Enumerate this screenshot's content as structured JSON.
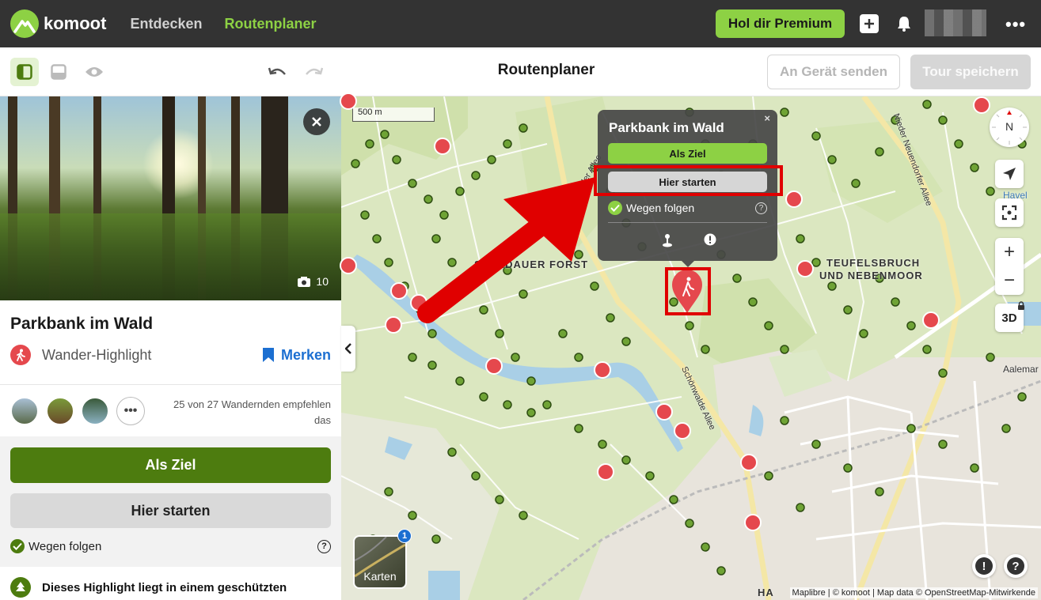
{
  "header": {
    "logo_text": "komoot",
    "nav": [
      {
        "label": "Entdecken",
        "active": false
      },
      {
        "label": "Routenplaner",
        "active": true
      }
    ],
    "premium_label": "Hol dir Premium",
    "more_label": "•••"
  },
  "toolbar": {
    "title": "Routenplaner",
    "send_label": "An Gerät senden",
    "save_label": "Tour speichern"
  },
  "sidebar": {
    "photo_count": "10",
    "highlight_title": "Parkbank im Wald",
    "highlight_type": "Wander-Highlight",
    "bookmark_label": "Merken",
    "recommend_text": "25 von 27 Wandernden empfehlen das",
    "more_avatars": "•••",
    "destination_label": "Als Ziel",
    "start_label": "Hier starten",
    "follow_paths_label": "Wegen folgen",
    "protected_text": "Dieses Highlight liegt in einem geschützten",
    "collapse_symbol": "‹"
  },
  "map": {
    "scale_label": "500 m",
    "labels": {
      "street_1": "Schönwalder Allee",
      "street_2": "Schönwalde Allee",
      "street_3": "Nieder Neuendorfer Allee",
      "area_1": "TEUFELSBRUCH",
      "area_2": "UND NEBENMOOR",
      "area_3": "SPANDAUER FORST",
      "area_3_fragment": "dauer",
      "place_havel": "Havel",
      "place_aalemann": "Aalemar",
      "place_bottom": "HA"
    },
    "popup": {
      "title": "Parkbank im Wald",
      "destination_label": "Als Ziel",
      "start_label": "Hier starten",
      "follow_paths_label": "Wegen folgen",
      "close_symbol": "×"
    },
    "compass_label": "N",
    "zoom_in": "+",
    "zoom_out": "−",
    "three_d_label": "3D",
    "maps_label": "Karten",
    "maps_badge": "1",
    "report_symbol": "!",
    "help_symbol": "?",
    "attribution": "Maplibre | © komoot | Map data © OpenStreetMap-Mitwirkende"
  },
  "colors": {
    "brand_green": "#8dd144",
    "dark_green": "#4d7c0f",
    "highlight_red": "#e5484d",
    "annotation_red": "#e00000",
    "link_blue": "#1c6fd1"
  }
}
